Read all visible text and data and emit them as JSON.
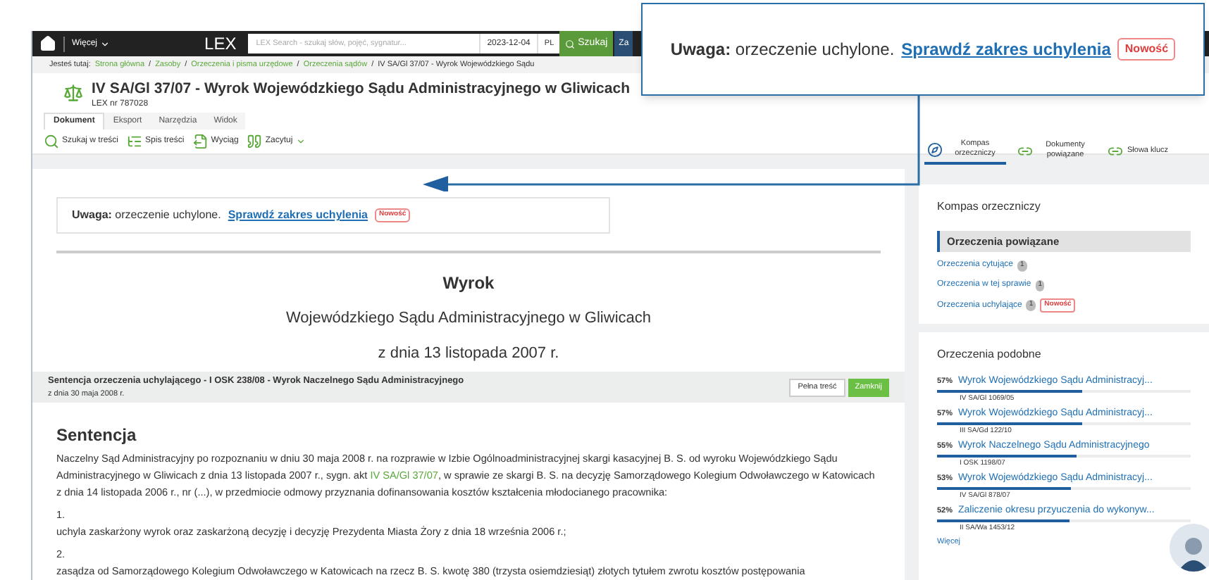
{
  "nav": {
    "more": "Więcej",
    "logo": "LEX",
    "search_placeholder": "LEX Search - szukaj słów, pojęć, sygnatur...",
    "date": "2023-12-04",
    "lang": "PL",
    "search_button": "Szukaj",
    "next_button": "Za"
  },
  "breadcrumb": {
    "label": "Jesteś tutaj:",
    "items": [
      {
        "text": "Strona główna",
        "separator": "/"
      },
      {
        "text": "Zasoby",
        "separator": "/"
      },
      {
        "text": "Orzeczenia i pisma urzędowe",
        "separator": "/"
      },
      {
        "text": "Orzeczenia sądów",
        "separator": "/"
      }
    ],
    "current": "IV SA/Gl 37/07 - Wyrok Wojewódzkiego Sądu"
  },
  "document": {
    "title": "IV SA/Gl 37/07 - Wyrok Wojewódzkiego Sądu Administracyjnego w Gliwicach",
    "lex_nr": "LEX nr 787028"
  },
  "tabs": [
    {
      "label": "Dokument",
      "selected": true
    },
    {
      "label": "Eksport",
      "selected": false
    },
    {
      "label": "Narzędzia",
      "selected": false
    },
    {
      "label": "Widok",
      "selected": false
    }
  ],
  "toolbar": [
    {
      "kind": "search",
      "label": "Szukaj w treści"
    },
    {
      "kind": "toc",
      "label": "Spis treści"
    },
    {
      "kind": "extract",
      "label": "Wyciąg"
    },
    {
      "kind": "quote",
      "label": "Zacytuj",
      "dropdown": true
    }
  ],
  "notice": {
    "text": "**Uwaga:** orzeczenie uchylone.",
    "link": "Sprawdź zakres uchylenia",
    "badge": "Nowość"
  },
  "heading": {
    "title": "Wyrok",
    "court": "Wojewódzkiego Sądu Administracyjnego w Gliwicach",
    "date": "z dnia 13 listopada 2007 r."
  },
  "related_bar": {
    "title": "Sentencja orzeczenia uchylającego - I OSK 238/08 - Wyrok Naczelnego Sądu Administracyjnego",
    "date": "z dnia 30 maja 2008 r.",
    "full_button": "Pełna treść",
    "close_button": "Zamknij"
  },
  "sentence": {
    "heading": "Sentencja",
    "paragraph_before": "Naczelny Sąd Administracyjny po rozpoznaniu w dniu 30 maja 2008 r. na rozprawie w Izbie Ogólnoadministracyjnej skargi kasacyjnej B. S. od wyroku Wojewódzkiego Sądu Administracyjnego w Gliwicach z dnia 13 listopada 2007 r., sygn. akt",
    "paragraph_link": "IV SA/Gl 37/07",
    "paragraph_after": ", w sprawie ze skargi B. S. na decyzję Samorządowego Kolegium Odwoławczego w Katowicach z dnia 14 listopada 2006 r., nr (...), w przedmiocie odmowy przyznania dofinansowania kosztów kształcenia młodocianego pracownika:",
    "points": [
      {
        "number": "1.",
        "text": "uchyla zaskarżony wyrok oraz zaskarżoną decyzję i decyzję Prezydenta Miasta Żory z dnia 18 września 2006 r.;"
      },
      {
        "number": "2.",
        "text": "zasądza od Samorządowego Kolegium Odwoławczego w Katowicach na rzecz B. S. kwotę 380 (trzysta osiemdziesiąt) złotych tytułem zwrotu kosztów postępowania"
      }
    ]
  },
  "side_tabs": [
    {
      "kind": "compass",
      "label": "Kompas orzeczniczy",
      "selected": true
    },
    {
      "kind": "link",
      "label": "Dokumenty powiązane",
      "selected": false
    },
    {
      "kind": "link",
      "label": "Słowa klucz",
      "selected": false
    }
  ],
  "compass": {
    "title": "Kompas orzeczniczy",
    "section": "Orzeczenia powiązane",
    "links": [
      {
        "label": "Orzeczenia cytujące",
        "count": "1"
      },
      {
        "label": "Orzeczenia w tej sprawie",
        "count": "1"
      },
      {
        "label": "Orzeczenia uchylające",
        "count": "1",
        "badge": "Nowość"
      }
    ]
  },
  "similar": {
    "title": "Orzeczenia podobne",
    "items": [
      {
        "percent": "57%",
        "title": "Wyrok Wojewódzkiego Sądu Administracyj...",
        "signature": "IV SA/Gl 1069/05",
        "level": 0.57
      },
      {
        "percent": "57%",
        "title": "Wyrok Wojewódzkiego Sądu Administracyj...",
        "signature": "III SA/Gd 122/10",
        "level": 0.57
      },
      {
        "percent": "55%",
        "title": "Wyrok Naczelnego Sądu Administracyjnego",
        "signature": "I OSK 1198/07",
        "level": 0.55
      },
      {
        "percent": "53%",
        "title": "Wyrok Wojewódzkiego Sądu Administracyj...",
        "signature": "IV SA/Gl 878/07",
        "level": 0.53
      },
      {
        "percent": "52%",
        "title": "Zaliczenie okresu przyuczenia do wykonyw...",
        "signature": "II SA/Wa 1453/12",
        "level": 0.52
      }
    ],
    "more": "Więcej"
  },
  "callout": {
    "text": "**Uwaga:** orzeczenie uchylone.",
    "link": "Sprawdź zakres uchylenia",
    "badge": "Nowość"
  }
}
